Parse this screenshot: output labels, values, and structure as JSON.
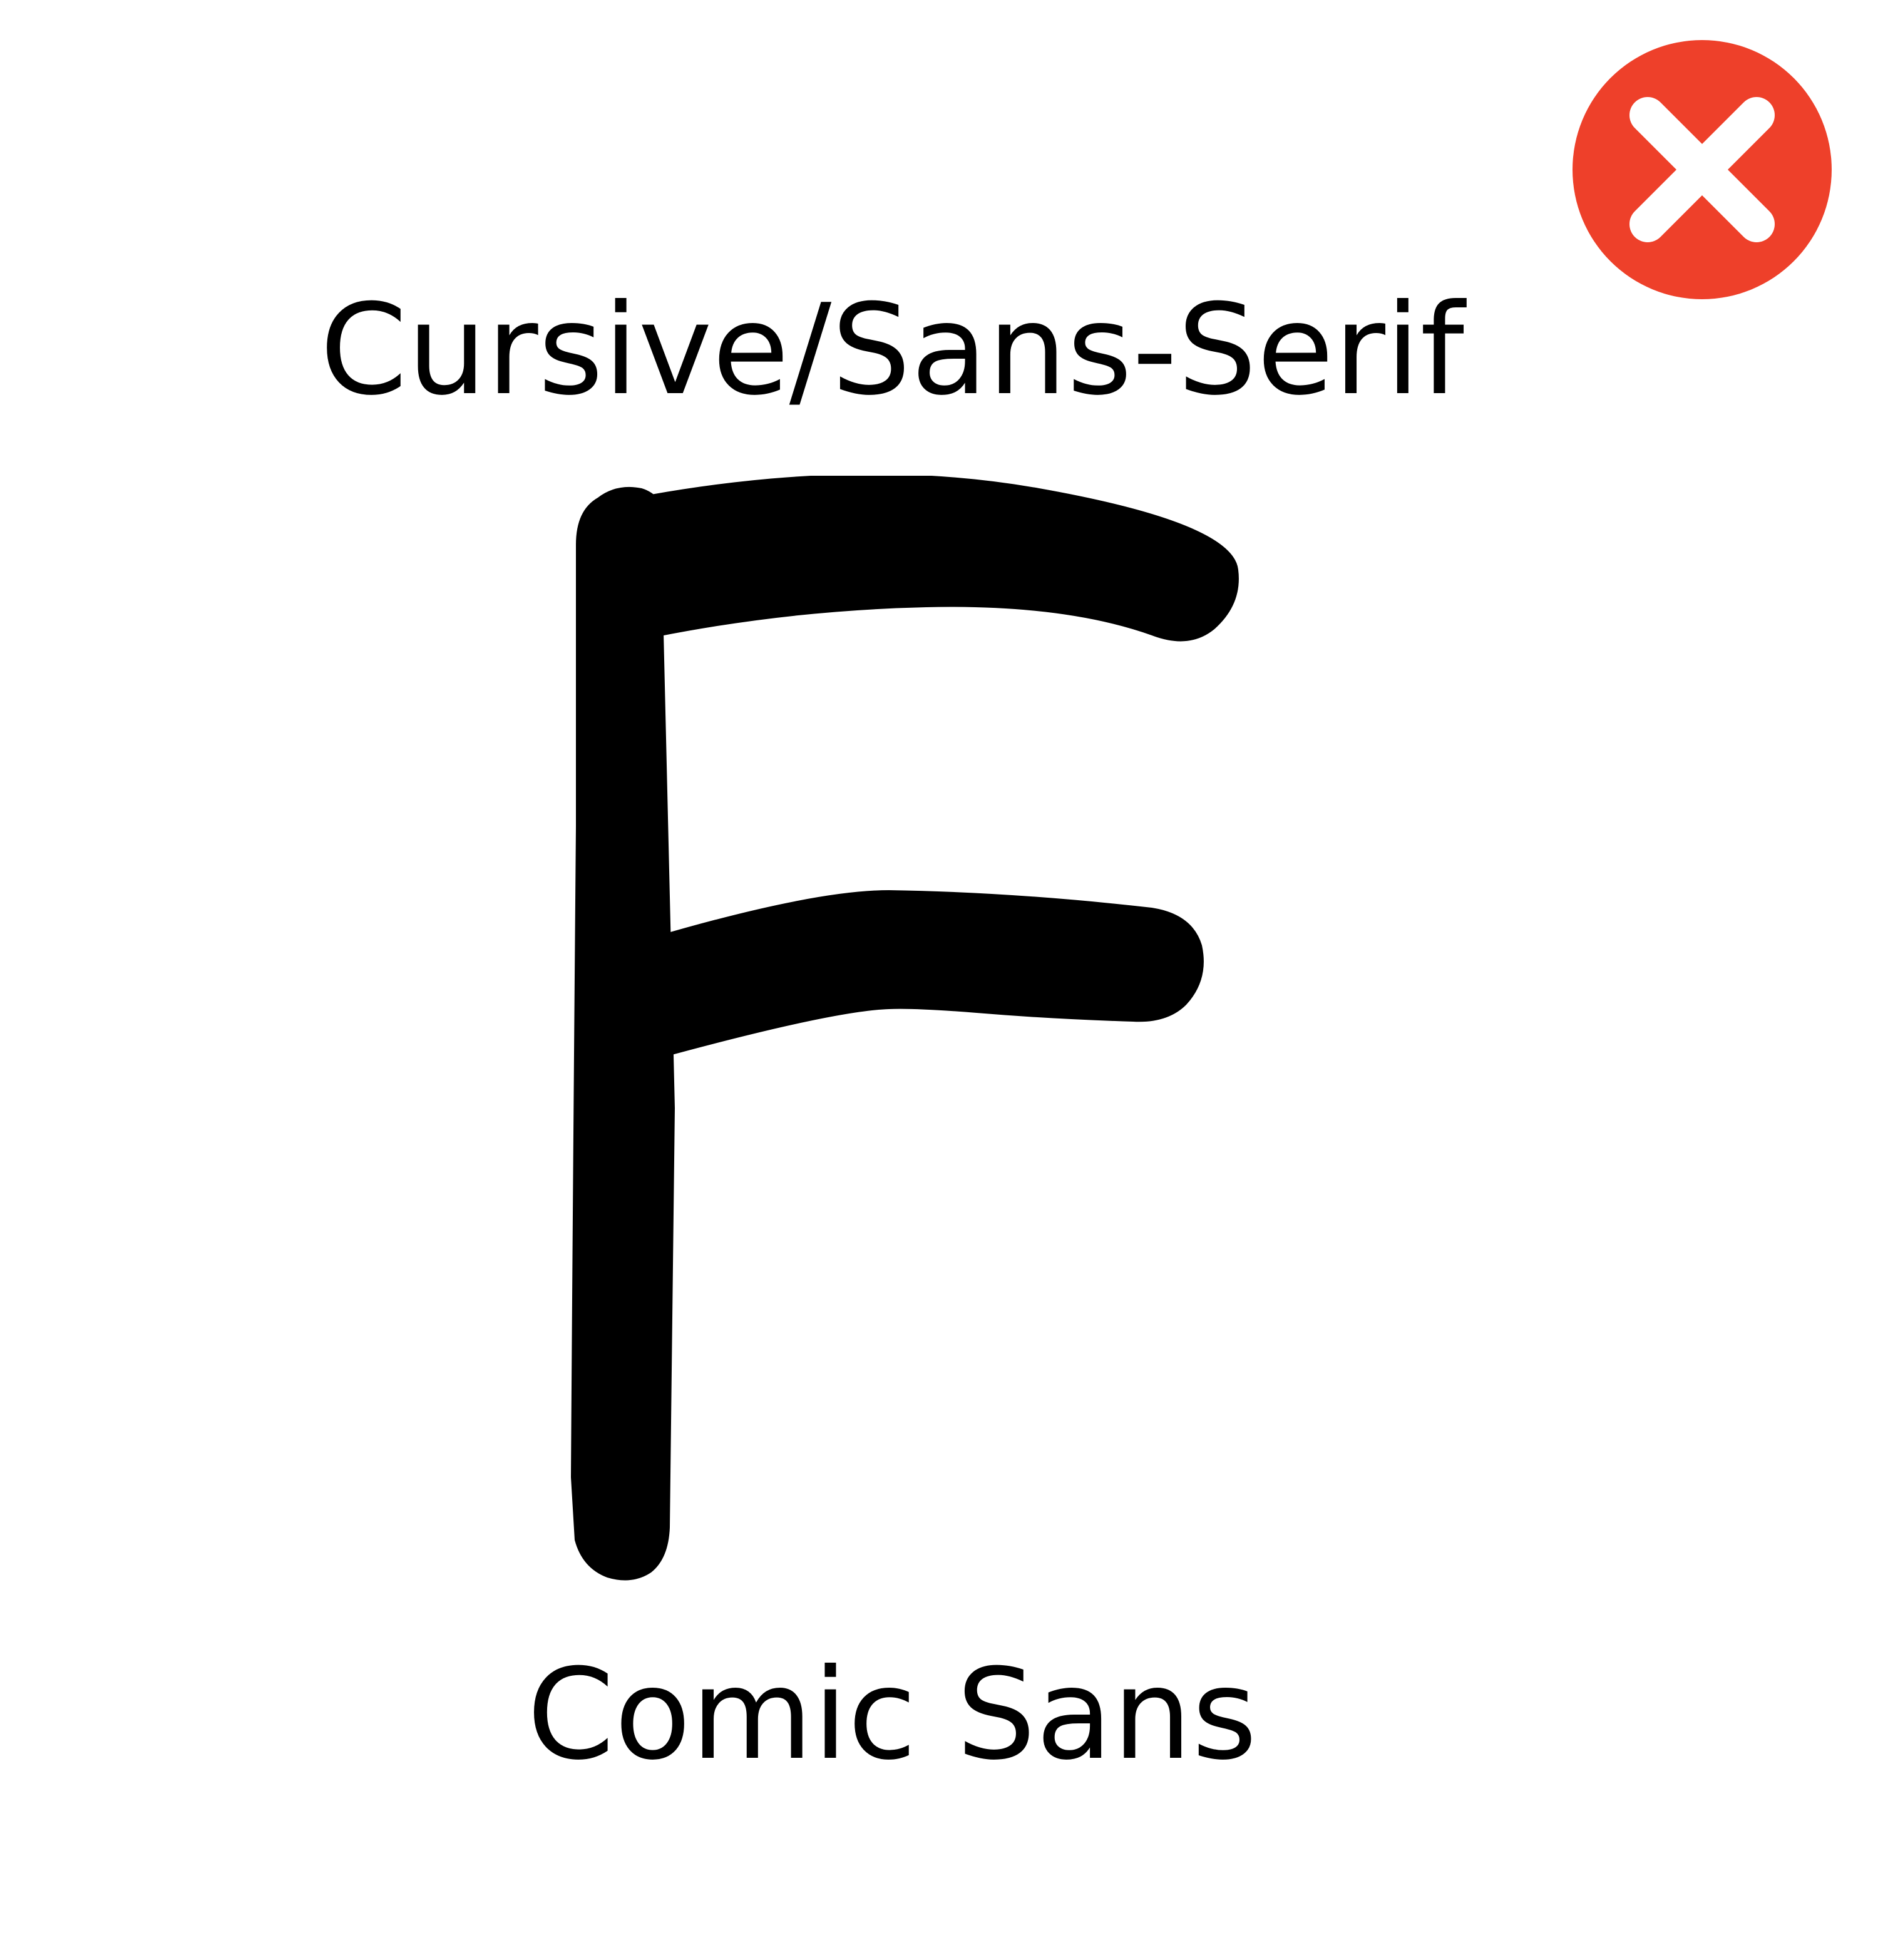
{
  "status": {
    "icon": "close-icon",
    "badge_color": "#EE402A",
    "mark_color": "#FFFFFF"
  },
  "specimen": {
    "category": "Cursive/Sans-Serif",
    "glyph": "F",
    "font_name": "Comic Sans",
    "text_color": "#000000"
  }
}
